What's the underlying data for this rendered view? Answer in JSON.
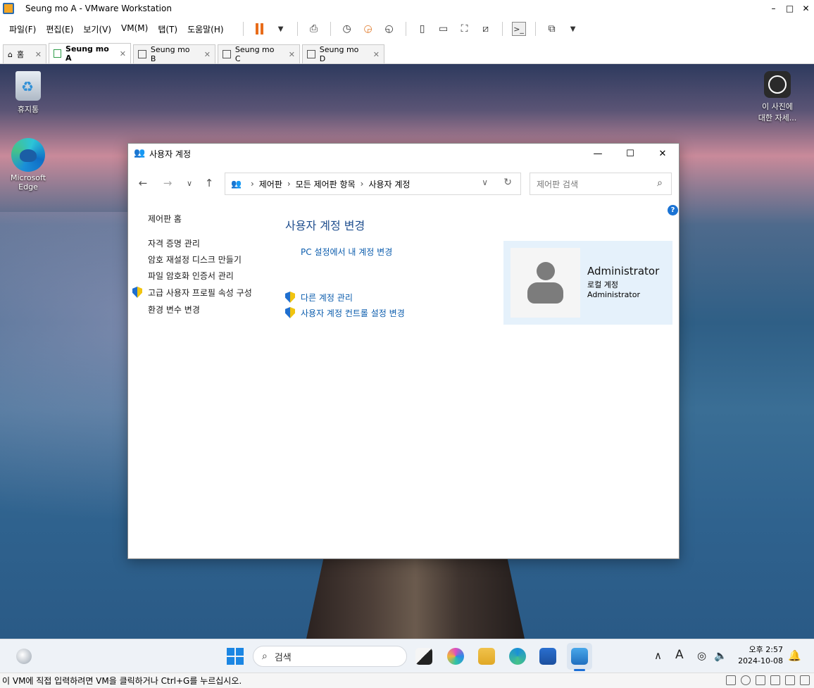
{
  "window": {
    "title": "Seung mo A - VMware Workstation",
    "minimize": "–",
    "maximize": "□",
    "close": "✕"
  },
  "menu": {
    "items": [
      "파일(F)",
      "편집(E)",
      "보기(V)",
      "VM(M)",
      "탭(T)",
      "도움말(H)"
    ]
  },
  "tabs": [
    {
      "label": "홈",
      "active": false
    },
    {
      "label": "Seung mo A",
      "active": true
    },
    {
      "label": "Seung mo B",
      "active": false
    },
    {
      "label": "Seung mo C",
      "active": false
    },
    {
      "label": "Seung mo D",
      "active": false
    }
  ],
  "desktop": {
    "recycle_bin": "휴지통",
    "edge_line1": "Microsoft",
    "edge_line2": "Edge",
    "photo_line1": "이 사진에",
    "photo_line2": "대한 자세..."
  },
  "control_panel": {
    "title": "사용자 계정",
    "breadcrumb": [
      "제어판",
      "모든 제어판 항목",
      "사용자 계정"
    ],
    "search_placeholder": "제어판 검색",
    "help": "?",
    "sidebar": {
      "home": "제어판 홈",
      "items": [
        "자격 증명 관리",
        "암호 재설정 디스크 만들기",
        "파일 암호화 인증서 관리",
        "고급 사용자 프로필 속성 구성",
        "환경 변수 변경"
      ]
    },
    "heading": "사용자 계정 변경",
    "link_pc_settings": "PC 설정에서 내 계정 변경",
    "link_other_accounts": "다른 계정 관리",
    "link_uac": "사용자 계정 컨트롤 설정 변경",
    "account": {
      "name": "Administrator",
      "type": "로컬 계정",
      "role": "Administrator"
    }
  },
  "taskbar": {
    "search_label": "검색",
    "time": "오후 2:57",
    "date": "2024-10-08",
    "ime": "A"
  },
  "status_bar": {
    "text": "이 VM에 직접 입력하려면 VM을 클릭하거나 Ctrl+G를 누르십시오."
  }
}
